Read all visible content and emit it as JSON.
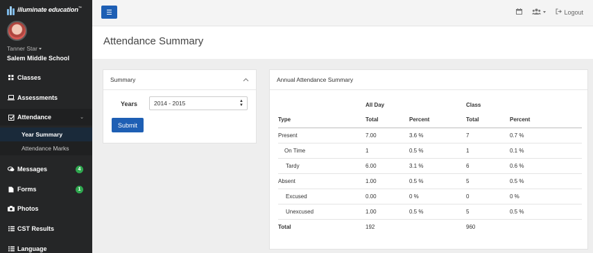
{
  "brand": {
    "name": "illuminate education",
    "tm": "™"
  },
  "user": {
    "name": "Tanner Star",
    "school": "Salem Middle School"
  },
  "sidebar": {
    "items": [
      {
        "label": "Classes",
        "icon": "grid-icon"
      },
      {
        "label": "Assessments",
        "icon": "laptop-icon"
      },
      {
        "label": "Attendance",
        "icon": "check-square-icon"
      },
      {
        "label": "Messages",
        "icon": "chat-icon",
        "badge": "4"
      },
      {
        "label": "Forms",
        "icon": "file-icon",
        "badge": "1"
      },
      {
        "label": "Photos",
        "icon": "camera-icon"
      },
      {
        "label": "CST Results",
        "icon": "list-icon"
      },
      {
        "label": "Language",
        "icon": "list-icon"
      }
    ],
    "attendance_sub": [
      {
        "label": "Year Summary",
        "active": true
      },
      {
        "label": "Attendance Marks",
        "active": false
      }
    ]
  },
  "topbar": {
    "logout_label": "Logout"
  },
  "page": {
    "title": "Attendance Summary"
  },
  "summary_panel": {
    "title": "Summary",
    "years_label": "Years",
    "years_value": "2014 - 2015",
    "submit_label": "Submit"
  },
  "annual_panel": {
    "title": "Annual Attendance Summary",
    "group_headers": {
      "all_day": "All Day",
      "class": "Class"
    },
    "columns": [
      "Type",
      "Total",
      "Percent",
      "Total",
      "Percent"
    ],
    "rows": [
      {
        "type": "Present",
        "level": 0,
        "ad_total": "7.00",
        "ad_pct": "3.6 %",
        "cl_total": "7",
        "cl_pct": "0.7 %"
      },
      {
        "type": "On Time",
        "level": 1,
        "ad_total": "1",
        "ad_pct": "0.5 %",
        "cl_total": "1",
        "cl_pct": "0.1 %"
      },
      {
        "type": "Tardy",
        "level": 2,
        "ad_total": "6.00",
        "ad_pct": "3.1 %",
        "cl_total": "6",
        "cl_pct": "0.6 %"
      },
      {
        "type": "Absent",
        "level": 0,
        "ad_total": "1.00",
        "ad_pct": "0.5 %",
        "cl_total": "5",
        "cl_pct": "0.5 %"
      },
      {
        "type": "Excused",
        "level": 2,
        "ad_total": "0.00",
        "ad_pct": "0 %",
        "cl_total": "0",
        "cl_pct": "0 %"
      },
      {
        "type": "Unexcused",
        "level": 2,
        "ad_total": "1.00",
        "ad_pct": "0.5 %",
        "cl_total": "5",
        "cl_pct": "0.5 %"
      }
    ],
    "total": {
      "label": "Total",
      "ad_total": "192",
      "cl_total": "960"
    }
  },
  "colors": {
    "primary": "#1e5fb4",
    "sidebar_bg": "#252627",
    "badge_green": "#2fa84f"
  }
}
